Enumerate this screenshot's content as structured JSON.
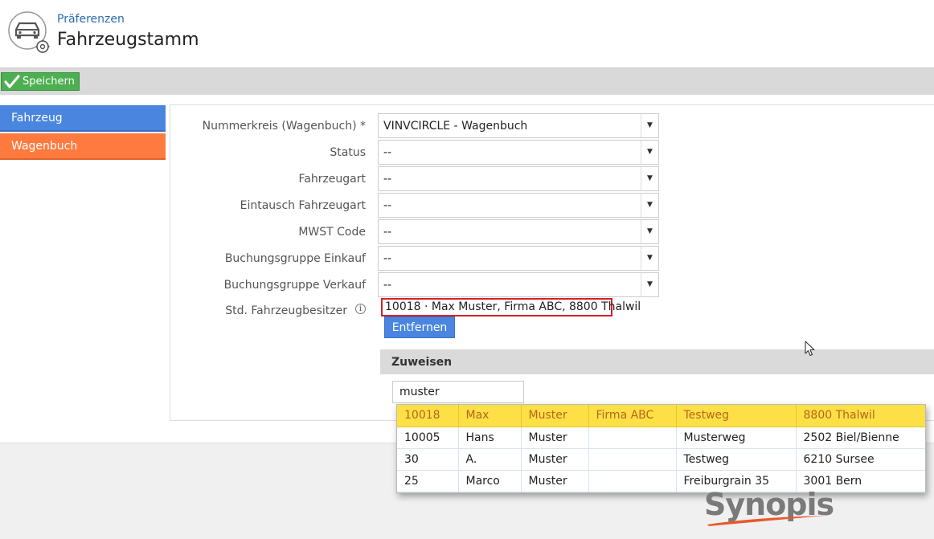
{
  "header": {
    "breadcrumb": "Präferenzen",
    "title": "Fahrzeugstamm",
    "icon": "car-settings-icon"
  },
  "toolbar": {
    "save_label": "Speichern",
    "save_icon": "checkmark-icon",
    "save_color": "#4caf50"
  },
  "sidebar": {
    "items": [
      {
        "label": "Fahrzeug",
        "color": "#4a86e0"
      },
      {
        "label": "Wagenbuch",
        "color": "#ff7a3f"
      }
    ]
  },
  "form": {
    "fields": [
      {
        "label": "Nummerkreis (Wagenbuch) *",
        "value": "VINVCIRCLE - Wagenbuch"
      },
      {
        "label": "Status",
        "value": "--"
      },
      {
        "label": "Fahrzeugart",
        "value": "--"
      },
      {
        "label": "Eintausch Fahrzeugart",
        "value": "--"
      },
      {
        "label": "MWST Code",
        "value": "--"
      },
      {
        "label": "Buchungsgruppe Einkauf",
        "value": "--"
      },
      {
        "label": "Buchungsgruppe Verkauf",
        "value": "--"
      }
    ],
    "owner": {
      "label": "Std. Fahrzeugbesitzer",
      "value": "10018 · Max Muster, Firma ABC, 8800 Thalwil",
      "highlight_color": "#d4202a"
    },
    "remove_label": "Entfernen"
  },
  "assign": {
    "title": "Zuweisen",
    "search_value": "muster"
  },
  "results": [
    {
      "nr": "10018",
      "first": "Max",
      "last": "Muster",
      "company": "Firma ABC",
      "street": "Testweg",
      "city": "8800 Thalwil"
    },
    {
      "nr": "10005",
      "first": "Hans",
      "last": "Muster",
      "company": "",
      "street": "Musterweg",
      "city": "2502 Biel/Bienne"
    },
    {
      "nr": "30",
      "first": "A.",
      "last": "Muster",
      "company": "",
      "street": "Testweg",
      "city": "6210 Sursee"
    },
    {
      "nr": "25",
      "first": "Marco",
      "last": "Muster",
      "company": "",
      "street": "Freiburgrain 35",
      "city": "3001 Bern"
    }
  ],
  "branding": {
    "logo_text": "Synopis"
  }
}
